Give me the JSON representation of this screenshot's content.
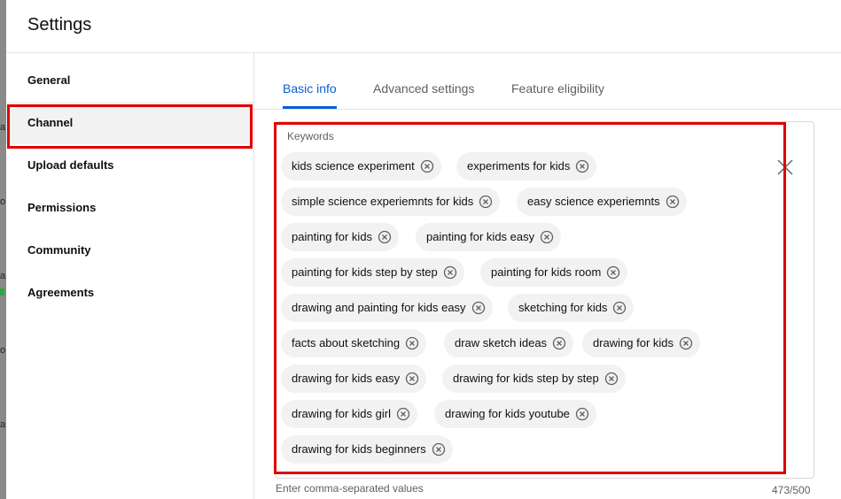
{
  "dialog": {
    "title": "Settings"
  },
  "sidebar": {
    "items": [
      {
        "label": "General",
        "active": false
      },
      {
        "label": "Channel",
        "active": true
      },
      {
        "label": "Upload defaults",
        "active": false
      },
      {
        "label": "Permissions",
        "active": false
      },
      {
        "label": "Community",
        "active": false
      },
      {
        "label": "Agreements",
        "active": false
      }
    ]
  },
  "tabs": [
    {
      "label": "Basic info",
      "active": true
    },
    {
      "label": "Advanced settings",
      "active": false
    },
    {
      "label": "Feature eligibility",
      "active": false
    }
  ],
  "keywords": {
    "label": "Keywords",
    "chips": [
      "kids science experiment",
      "experiments for kids",
      "simple science experiemnts for kids",
      "easy science experiemnts",
      "painting for kids",
      "painting for kids easy",
      "painting for kids step by step",
      "painting for kids room",
      "drawing and painting for kids easy",
      "sketching for kids",
      "facts about sketching",
      "draw sketch ideas",
      "drawing for kids",
      "drawing for kids easy",
      "drawing for kids step by step",
      "drawing for kids girl",
      "drawing for kids youtube",
      "drawing for kids beginners"
    ],
    "helper_text": "Enter comma-separated values",
    "counter": "473/500"
  },
  "colors": {
    "accent": "#065fd4",
    "highlight": "#e00000",
    "chip_bg": "#f2f2f2"
  }
}
